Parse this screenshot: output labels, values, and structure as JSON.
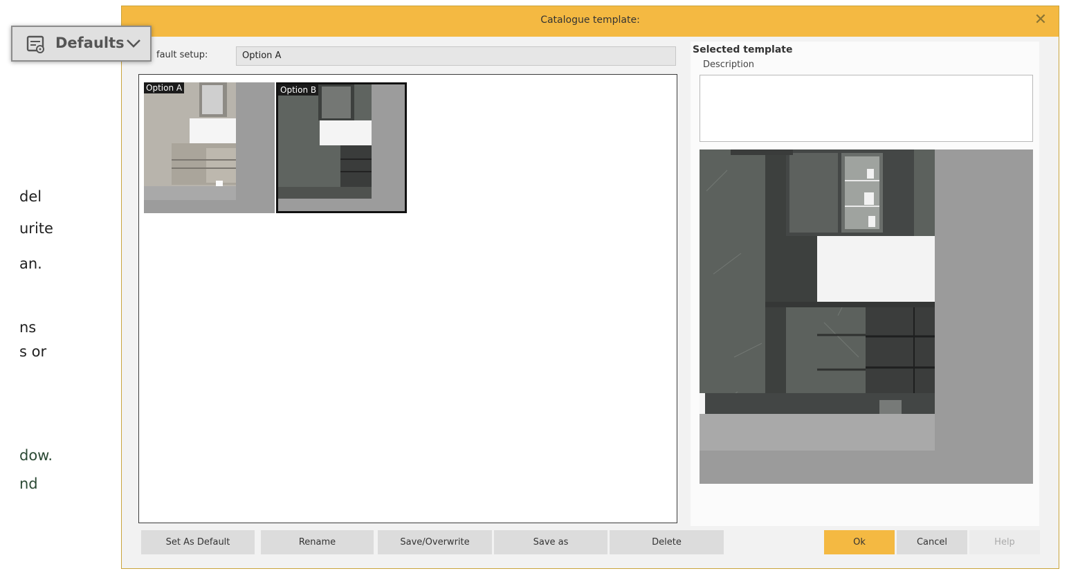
{
  "background_text": [
    "del",
    "urite",
    "an.",
    "ns",
    "s or",
    "dow.",
    "nd"
  ],
  "dialog": {
    "title": "Catalogue template:",
    "default_setup_label": "fault setup:",
    "default_setup_value": "Option A",
    "thumbnails": [
      {
        "label": "Option A",
        "selected": false
      },
      {
        "label": "Option B",
        "selected": true
      }
    ],
    "selected_template_title": "Selected template",
    "description_label": "Description",
    "description_value": "",
    "buttons": {
      "set_default": "Set As Default",
      "rename": "Rename",
      "save_overwrite": "Save/Overwrite",
      "save_as": "Save as",
      "delete": "Delete",
      "ok": "Ok",
      "cancel": "Cancel",
      "help": "Help"
    }
  },
  "defaults_button": {
    "label": "Defaults",
    "icon": "template-icon",
    "chevron": "chevron-down-icon"
  },
  "colors": {
    "accent": "#f4b942"
  }
}
